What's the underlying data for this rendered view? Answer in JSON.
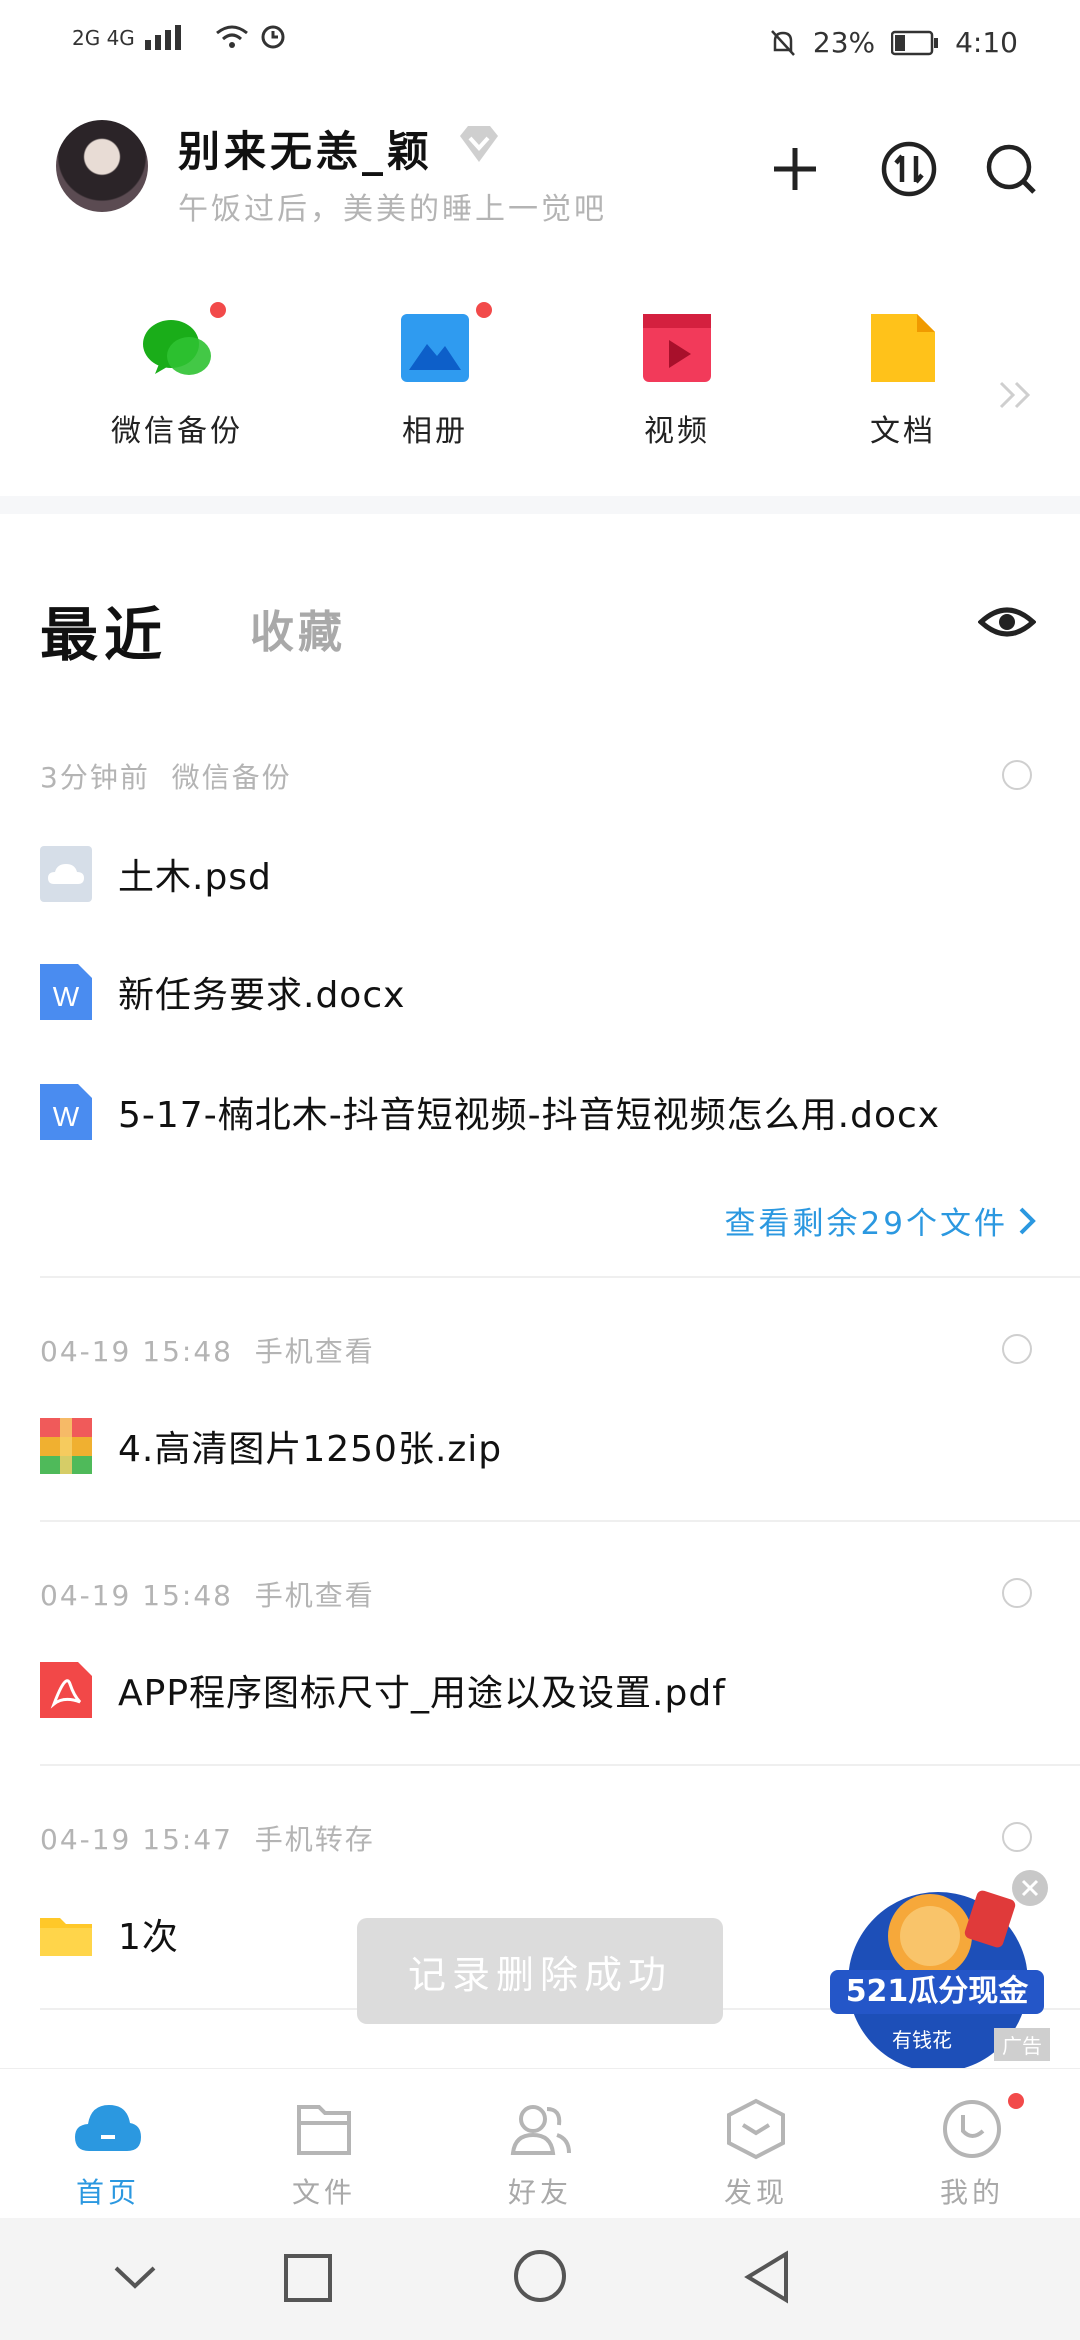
{
  "status_bar": {
    "left_signal": "2G 4G",
    "battery": "23%",
    "time": "4:10"
  },
  "profile": {
    "username": "别来无恙_颖",
    "signature": "午饭过后，美美的睡上一觉吧"
  },
  "quick_access": [
    {
      "label": "微信备份",
      "icon": "wechat-icon",
      "badge": true
    },
    {
      "label": "相册",
      "icon": "album-icon",
      "badge": true
    },
    {
      "label": "视频",
      "icon": "video-icon",
      "badge": false
    },
    {
      "label": "文档",
      "icon": "document-icon",
      "badge": false
    }
  ],
  "tabs": {
    "recent": "最近",
    "favorites": "收藏"
  },
  "groups": [
    {
      "time": "3分钟前",
      "source": "微信备份",
      "files": [
        "土木.psd",
        "新任务要求.docx",
        "5-17-楠北木-抖音短视频-抖音短视频怎么用.docx"
      ],
      "more": "查看剩余29个文件"
    },
    {
      "time": "04-19 15:48",
      "source": "手机查看",
      "files": [
        "4.高清图片1250张.zip"
      ]
    },
    {
      "time": "04-19 15:48",
      "source": "手机查看",
      "files": [
        "APP程序图标尺寸_用途以及设置.pdf"
      ]
    },
    {
      "time": "04-19 15:47",
      "source": "手机转存",
      "files": [
        "1次"
      ]
    }
  ],
  "toast": "记录删除成功",
  "ad": {
    "title": "521瓜分现金",
    "brand": "有钱花",
    "tag": "广告"
  },
  "bottom_nav": [
    {
      "label": "首页",
      "icon": "cloud-home-icon",
      "active": true
    },
    {
      "label": "文件",
      "icon": "folder-icon",
      "active": false
    },
    {
      "label": "好友",
      "icon": "friends-icon",
      "active": false
    },
    {
      "label": "发现",
      "icon": "discover-icon",
      "active": false
    },
    {
      "label": "我的",
      "icon": "profile-icon",
      "active": false
    }
  ],
  "colors": {
    "accent": "#2b98e0",
    "badge": "#f24a4a",
    "inactive": "#a9a9a9"
  }
}
